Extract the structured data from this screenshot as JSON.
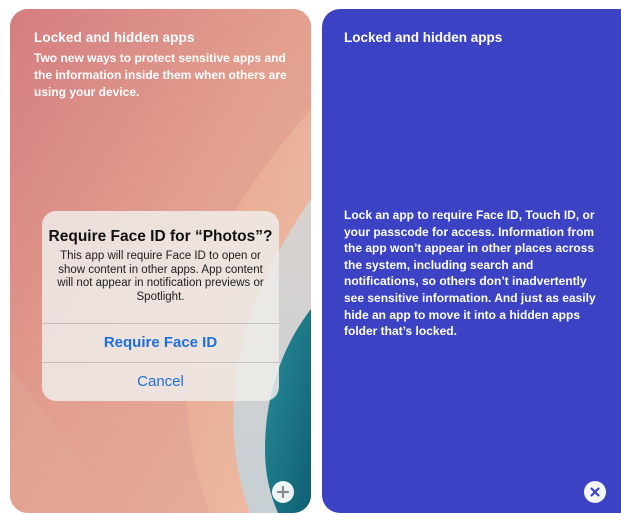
{
  "left_card": {
    "title": "Locked and hidden apps",
    "description": "Two new ways to protect sensitive apps and the information inside them when others are using your device.",
    "alert": {
      "title": "Require Face ID for “Photos”?",
      "message": "This app will require Face ID to open or show content in other apps. App content will not appear in notification previews or Spotlight.",
      "primary_button": "Require Face ID",
      "cancel_button": "Cancel"
    },
    "add_button_icon": "plus-icon"
  },
  "right_card": {
    "title": "Locked and hidden apps",
    "body": "Lock an app to require Face ID, Touch ID, or your passcode for access. Information from the app won’t appear in other places across the system, including search and notifications, so others don’t inadvertently see sensitive information. And just as easily hide an app to move it into a hidden apps folder that’s locked.",
    "close_button_icon": "close-icon"
  },
  "colors": {
    "right_card_background": "#3b43c4",
    "alert_button_text": "#1e6fd6"
  }
}
